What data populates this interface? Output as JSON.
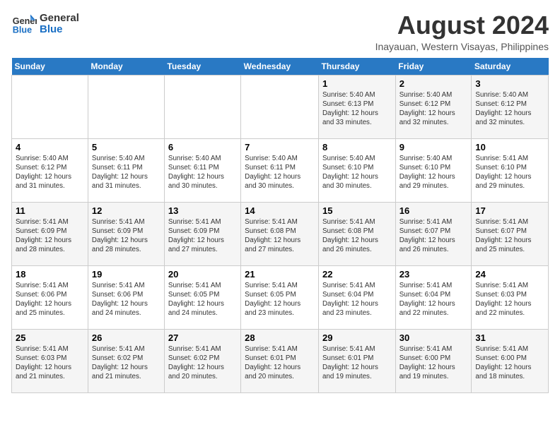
{
  "header": {
    "logo_line1": "General",
    "logo_line2": "Blue",
    "month_year": "August 2024",
    "location": "Inayauan, Western Visayas, Philippines"
  },
  "days_of_week": [
    "Sunday",
    "Monday",
    "Tuesday",
    "Wednesday",
    "Thursday",
    "Friday",
    "Saturday"
  ],
  "weeks": [
    [
      {
        "day": "",
        "info": ""
      },
      {
        "day": "",
        "info": ""
      },
      {
        "day": "",
        "info": ""
      },
      {
        "day": "",
        "info": ""
      },
      {
        "day": "1",
        "info": "Sunrise: 5:40 AM\nSunset: 6:13 PM\nDaylight: 12 hours\nand 33 minutes."
      },
      {
        "day": "2",
        "info": "Sunrise: 5:40 AM\nSunset: 6:12 PM\nDaylight: 12 hours\nand 32 minutes."
      },
      {
        "day": "3",
        "info": "Sunrise: 5:40 AM\nSunset: 6:12 PM\nDaylight: 12 hours\nand 32 minutes."
      }
    ],
    [
      {
        "day": "4",
        "info": "Sunrise: 5:40 AM\nSunset: 6:12 PM\nDaylight: 12 hours\nand 31 minutes."
      },
      {
        "day": "5",
        "info": "Sunrise: 5:40 AM\nSunset: 6:11 PM\nDaylight: 12 hours\nand 31 minutes."
      },
      {
        "day": "6",
        "info": "Sunrise: 5:40 AM\nSunset: 6:11 PM\nDaylight: 12 hours\nand 30 minutes."
      },
      {
        "day": "7",
        "info": "Sunrise: 5:40 AM\nSunset: 6:11 PM\nDaylight: 12 hours\nand 30 minutes."
      },
      {
        "day": "8",
        "info": "Sunrise: 5:40 AM\nSunset: 6:10 PM\nDaylight: 12 hours\nand 30 minutes."
      },
      {
        "day": "9",
        "info": "Sunrise: 5:40 AM\nSunset: 6:10 PM\nDaylight: 12 hours\nand 29 minutes."
      },
      {
        "day": "10",
        "info": "Sunrise: 5:41 AM\nSunset: 6:10 PM\nDaylight: 12 hours\nand 29 minutes."
      }
    ],
    [
      {
        "day": "11",
        "info": "Sunrise: 5:41 AM\nSunset: 6:09 PM\nDaylight: 12 hours\nand 28 minutes."
      },
      {
        "day": "12",
        "info": "Sunrise: 5:41 AM\nSunset: 6:09 PM\nDaylight: 12 hours\nand 28 minutes."
      },
      {
        "day": "13",
        "info": "Sunrise: 5:41 AM\nSunset: 6:09 PM\nDaylight: 12 hours\nand 27 minutes."
      },
      {
        "day": "14",
        "info": "Sunrise: 5:41 AM\nSunset: 6:08 PM\nDaylight: 12 hours\nand 27 minutes."
      },
      {
        "day": "15",
        "info": "Sunrise: 5:41 AM\nSunset: 6:08 PM\nDaylight: 12 hours\nand 26 minutes."
      },
      {
        "day": "16",
        "info": "Sunrise: 5:41 AM\nSunset: 6:07 PM\nDaylight: 12 hours\nand 26 minutes."
      },
      {
        "day": "17",
        "info": "Sunrise: 5:41 AM\nSunset: 6:07 PM\nDaylight: 12 hours\nand 25 minutes."
      }
    ],
    [
      {
        "day": "18",
        "info": "Sunrise: 5:41 AM\nSunset: 6:06 PM\nDaylight: 12 hours\nand 25 minutes."
      },
      {
        "day": "19",
        "info": "Sunrise: 5:41 AM\nSunset: 6:06 PM\nDaylight: 12 hours\nand 24 minutes."
      },
      {
        "day": "20",
        "info": "Sunrise: 5:41 AM\nSunset: 6:05 PM\nDaylight: 12 hours\nand 24 minutes."
      },
      {
        "day": "21",
        "info": "Sunrise: 5:41 AM\nSunset: 6:05 PM\nDaylight: 12 hours\nand 23 minutes."
      },
      {
        "day": "22",
        "info": "Sunrise: 5:41 AM\nSunset: 6:04 PM\nDaylight: 12 hours\nand 23 minutes."
      },
      {
        "day": "23",
        "info": "Sunrise: 5:41 AM\nSunset: 6:04 PM\nDaylight: 12 hours\nand 22 minutes."
      },
      {
        "day": "24",
        "info": "Sunrise: 5:41 AM\nSunset: 6:03 PM\nDaylight: 12 hours\nand 22 minutes."
      }
    ],
    [
      {
        "day": "25",
        "info": "Sunrise: 5:41 AM\nSunset: 6:03 PM\nDaylight: 12 hours\nand 21 minutes."
      },
      {
        "day": "26",
        "info": "Sunrise: 5:41 AM\nSunset: 6:02 PM\nDaylight: 12 hours\nand 21 minutes."
      },
      {
        "day": "27",
        "info": "Sunrise: 5:41 AM\nSunset: 6:02 PM\nDaylight: 12 hours\nand 20 minutes."
      },
      {
        "day": "28",
        "info": "Sunrise: 5:41 AM\nSunset: 6:01 PM\nDaylight: 12 hours\nand 20 minutes."
      },
      {
        "day": "29",
        "info": "Sunrise: 5:41 AM\nSunset: 6:01 PM\nDaylight: 12 hours\nand 19 minutes."
      },
      {
        "day": "30",
        "info": "Sunrise: 5:41 AM\nSunset: 6:00 PM\nDaylight: 12 hours\nand 19 minutes."
      },
      {
        "day": "31",
        "info": "Sunrise: 5:41 AM\nSunset: 6:00 PM\nDaylight: 12 hours\nand 18 minutes."
      }
    ]
  ]
}
